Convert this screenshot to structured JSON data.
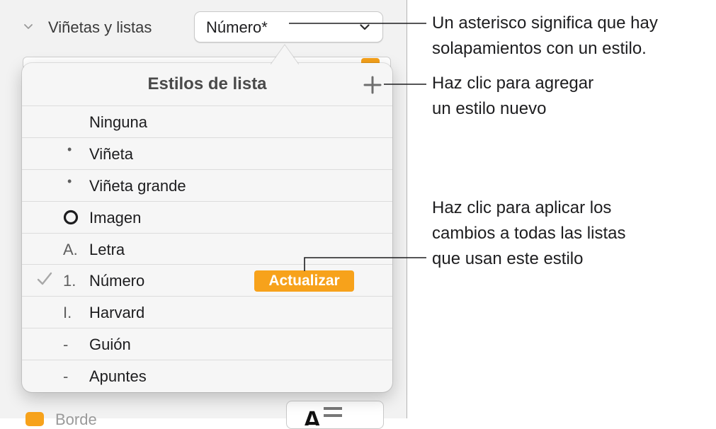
{
  "inspector": {
    "section_label": "Viñetas y listas",
    "list_style_value": "Número*",
    "obscured_label": "Borde"
  },
  "popover": {
    "title": "Estilos de lista",
    "items": [
      {
        "marker": "",
        "label": "Ninguna",
        "selected": false
      },
      {
        "marker": "•",
        "label": "Viñeta",
        "selected": false
      },
      {
        "marker": "•",
        "label": "Viñeta grande",
        "selected": false
      },
      {
        "marker": "ring",
        "label": "Imagen",
        "selected": false
      },
      {
        "marker": "A.",
        "label": "Letra",
        "selected": false
      },
      {
        "marker": "1.",
        "label": "Número",
        "selected": true
      },
      {
        "marker": "I.",
        "label": "Harvard",
        "selected": false
      },
      {
        "marker": "-",
        "label": "Guión",
        "selected": false
      },
      {
        "marker": "-",
        "label": "Apuntes",
        "selected": false
      }
    ],
    "update_label": "Actualizar"
  },
  "callouts": {
    "asterisk": [
      "Un asterisco significa que hay",
      "solapamientos con un estilo."
    ],
    "add": [
      "Haz clic para agregar",
      "un estilo nuevo"
    ],
    "update": [
      "Haz clic para aplicar los",
      "cambios a todas las listas",
      "que usan este estilo"
    ]
  },
  "colors": {
    "accent_orange": "#f7a21b",
    "panel_bg": "#f2f2f2",
    "popover_bg": "#f6f6f6"
  },
  "icons": [
    "chevron-down-icon",
    "dropdown-arrow-icon",
    "plus-icon",
    "checkmark-icon",
    "ring-icon",
    "text-align-icon"
  ]
}
